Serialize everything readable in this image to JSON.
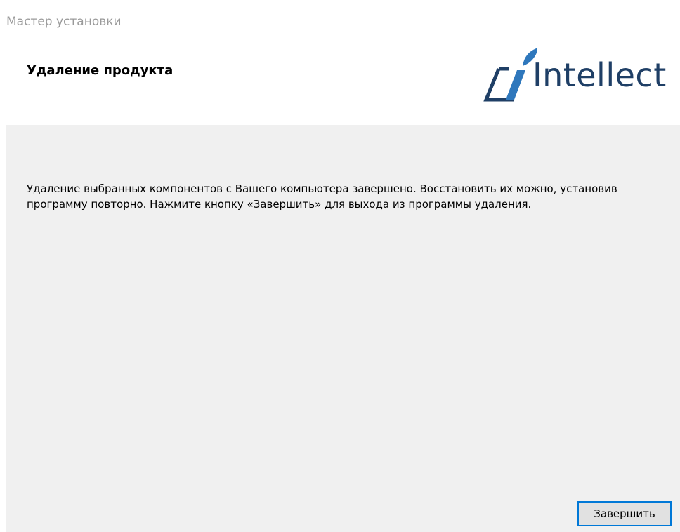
{
  "window": {
    "title": "Мастер установки"
  },
  "header": {
    "title": "Удаление продукта",
    "logo_text": "Intellect"
  },
  "main": {
    "message": "Удаление выбранных компонентов с Вашего компьютера завершено. Восстановить их можно, установив программу повторно. Нажмите кнопку «Завершить» для выхода из программы удаления."
  },
  "buttons": {
    "finish_label": "Завершить"
  },
  "colors": {
    "logo_primary": "#1f3f66",
    "logo_accent": "#2e77bc",
    "button_focus_border": "#0078d7",
    "body_background": "#f0f0f0"
  },
  "icons": {
    "logo_mark": "intellect-logo-icon"
  }
}
